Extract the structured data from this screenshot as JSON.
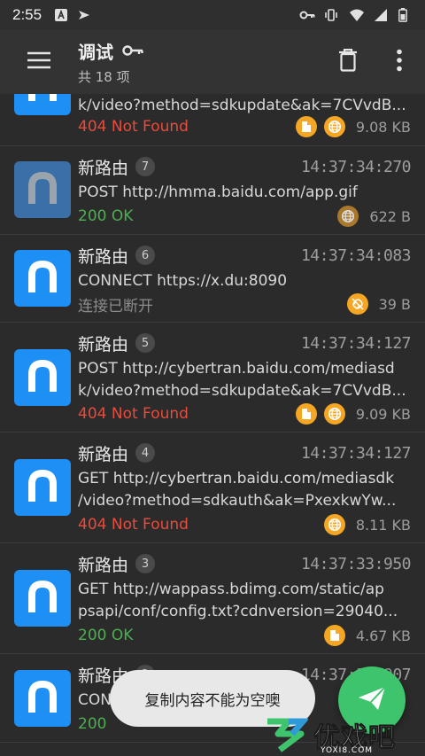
{
  "status_bar": {
    "time": "2:55",
    "left_icons": [
      "notification-a-icon",
      "bird-icon"
    ],
    "right_icons": [
      "key-icon",
      "vibrate-icon",
      "wifi-icon",
      "signal-icon",
      "battery-icon"
    ]
  },
  "app_bar": {
    "title": "调试",
    "subtitle": "共 18 项",
    "title_icon": "key-icon",
    "actions": [
      "trash-icon",
      "more-vert-icon"
    ]
  },
  "rows": [
    {
      "name": "",
      "index": "",
      "time": "",
      "url_lines": [
        "k/video?method=sdkupdate&ak=7CVvdB..."
      ],
      "status": "404 Not Found",
      "status_color": "red",
      "badges": [
        "file-icon",
        "globe-icon"
      ],
      "size": "9.08 KB",
      "icon_style": "bright"
    },
    {
      "name": "新路由",
      "index": "7",
      "time": "14:37:34:270",
      "url_lines": [
        "POST http://hmma.baidu.com/app.gif"
      ],
      "status": "200 OK",
      "status_color": "green",
      "badges": [
        "globe-icon"
      ],
      "size": "622 B",
      "icon_style": "dim"
    },
    {
      "name": "新路由",
      "index": "6",
      "time": "14:37:34:083",
      "url_lines": [
        "CONNECT https://x.du:8090"
      ],
      "status": "连接已断开",
      "status_color": "gray",
      "badges": [
        "link-off-icon"
      ],
      "size": "39 B",
      "icon_style": "bright"
    },
    {
      "name": "新路由",
      "index": "5",
      "time": "14:37:34:127",
      "url_lines": [
        "POST http://cybertran.baidu.com/mediasd",
        "k/video?method=sdkupdate&ak=7CVvdB..."
      ],
      "status": "404 Not Found",
      "status_color": "red",
      "badges": [
        "file-icon",
        "globe-icon"
      ],
      "size": "9.09 KB",
      "icon_style": "bright"
    },
    {
      "name": "新路由",
      "index": "4",
      "time": "14:37:34:127",
      "url_lines": [
        "GET http://cybertran.baidu.com/mediasdk",
        "/video?method=sdkauth&ak=PxexkwYw..."
      ],
      "status": "404 Not Found",
      "status_color": "red",
      "badges": [
        "globe-icon"
      ],
      "size": "8.11 KB",
      "icon_style": "bright"
    },
    {
      "name": "新路由",
      "index": "3",
      "time": "14:37:33:950",
      "url_lines": [
        "GET http://wappass.bdimg.com/static/ap",
        "psapi/conf/config.txt?cdnversion=29040..."
      ],
      "status": "200 OK",
      "status_color": "green",
      "badges": [
        "file-icon"
      ],
      "size": "4.67 KB",
      "icon_style": "bright"
    },
    {
      "name": "新路由",
      "index": "2",
      "time": "14:37:33:907",
      "url_lines": [
        "CONNE"
      ],
      "status": "200",
      "status_color": "green",
      "badges": [],
      "size": "",
      "icon_style": "bright"
    }
  ],
  "toast": {
    "text": "复制内容不能为空噢"
  },
  "fab": {
    "icon": "send-icon"
  },
  "watermark": {
    "text": "优戏吧",
    "url": "YOXI8.COM"
  },
  "colors": {
    "accent_blue": "#1e8ff5",
    "fab_green": "#3ec46d",
    "badge_orange": "#f5a623",
    "error_red": "#e74c3c",
    "ok_green": "#4caf50"
  }
}
